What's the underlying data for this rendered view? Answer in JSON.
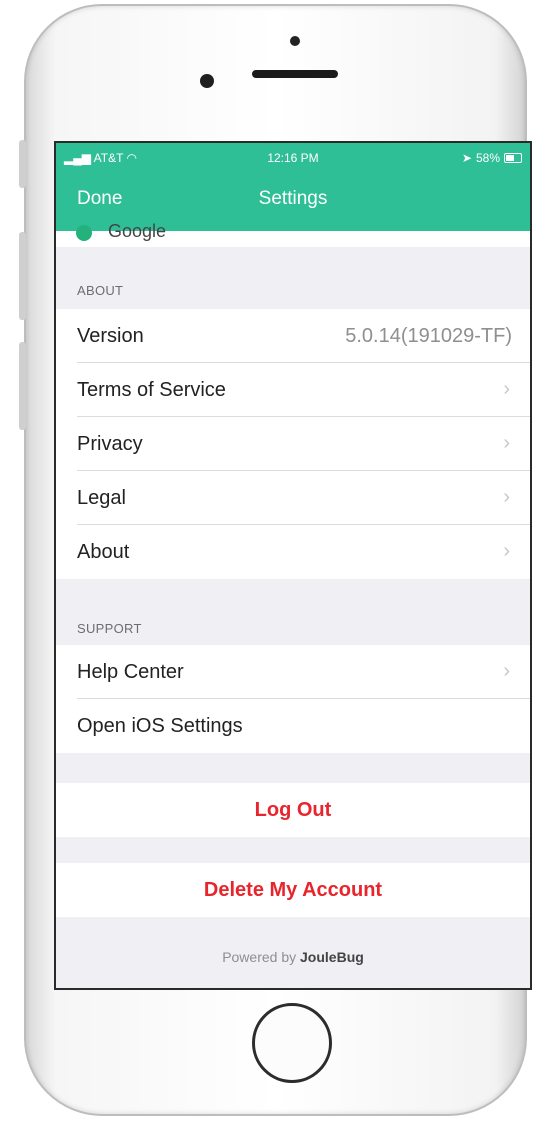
{
  "status_bar": {
    "carrier": "AT&T",
    "time": "12:16 PM",
    "battery": "58%",
    "battery_level": 0.58
  },
  "nav": {
    "done_label": "Done",
    "title": "Settings"
  },
  "partial_row_text": "Google",
  "about": {
    "header": "ABOUT",
    "version_label": "Version",
    "version_value": "5.0.14(191029-TF)",
    "items": [
      {
        "label": "Terms of Service"
      },
      {
        "label": "Privacy"
      },
      {
        "label": "Legal"
      },
      {
        "label": "About"
      }
    ]
  },
  "support": {
    "header": "SUPPORT",
    "help_label": "Help Center",
    "ios_settings_label": "Open iOS Settings"
  },
  "chevron": "›",
  "logout_label": "Log Out",
  "delete_label": "Delete My Account",
  "footer": {
    "prefix": "Powered by",
    "brand": "JouleBug"
  },
  "colors": {
    "header": "#2fbf96",
    "destructive": "#e8252c",
    "background": "#efeff4"
  }
}
